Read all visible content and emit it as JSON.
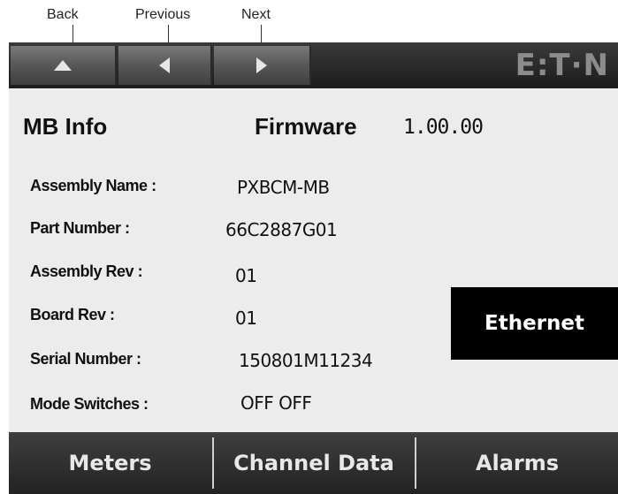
{
  "callouts": {
    "back": "Back",
    "previous": "Previous",
    "next": "Next"
  },
  "header": {
    "logo": "E:T·N"
  },
  "page": {
    "title": "MB Info",
    "firmware_label": "Firmware",
    "firmware_value": "1.00.00"
  },
  "fields": [
    {
      "label": "Assembly Name :",
      "value": "PXBCM-MB"
    },
    {
      "label": "Part Number :",
      "value": "66C2887G01"
    },
    {
      "label": "Assembly Rev :",
      "value": "01"
    },
    {
      "label": "Board Rev :",
      "value": "01"
    },
    {
      "label": "Serial Number :",
      "value": "150801M11234"
    },
    {
      "label": "Mode Switches :",
      "value": "OFF OFF"
    }
  ],
  "ethernet_button": "Ethernet",
  "bottom_tabs": [
    {
      "label": "Meters"
    },
    {
      "label": "Channel Data"
    },
    {
      "label": "Alarms"
    }
  ],
  "icons": [
    "up-arrow-icon",
    "left-arrow-icon",
    "right-arrow-icon"
  ]
}
